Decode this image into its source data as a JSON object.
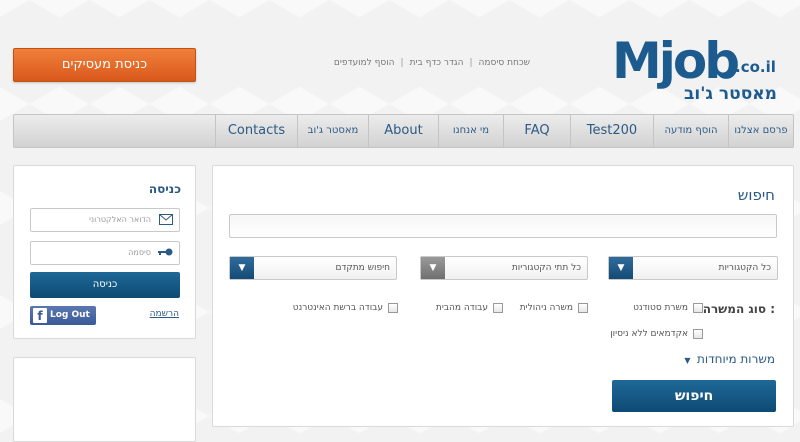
{
  "header": {
    "employer_button": "כניסת מעסיקים",
    "links": [
      "שכחת סיסמה",
      "הגדר כדף בית",
      "הוסף למועדפים"
    ],
    "logo": {
      "main": "Mjob",
      "suffix": ".co.il",
      "hebrew": "מאסטר ג'וב"
    }
  },
  "nav": {
    "items": [
      {
        "label": "פרסם אצלנו",
        "big": false
      },
      {
        "label": "הוסף מודעה",
        "big": false
      },
      {
        "label": "Test200",
        "big": true
      },
      {
        "label": "FAQ",
        "big": true
      },
      {
        "label": "מי אנחנו",
        "big": false
      },
      {
        "label": "About",
        "big": true
      },
      {
        "label": "מאסטר ג'וב",
        "big": false
      },
      {
        "label": "Contacts",
        "big": true
      }
    ]
  },
  "search": {
    "title": "חיפוש",
    "selects": {
      "categories": "כל הקטגוריות",
      "subcategories": "כל תתי הקטגוריות",
      "advanced": "חיפוש מתקדם"
    },
    "job_type_label": "סוג המשרה :",
    "checkboxes": [
      "משרת סטודנט",
      "משרה ניהולית",
      "עבודה מהבית",
      "עבודה ברשת האינטרנט",
      "אקדמאים ללא ניסיון"
    ],
    "special_jobs": "משרות מיוחדות",
    "search_button": "חיפוש"
  },
  "login": {
    "title": "כניסה",
    "email_placeholder": "הדואר האלקטרוני",
    "password_placeholder": "סיסמה",
    "login_button": "כניסה",
    "facebook_button": "Log Out",
    "register_link": "הרשמה"
  },
  "colors": {
    "accent": "#1d5b8f",
    "orange": "#e0642a",
    "nav_text": "#2b5a84"
  }
}
